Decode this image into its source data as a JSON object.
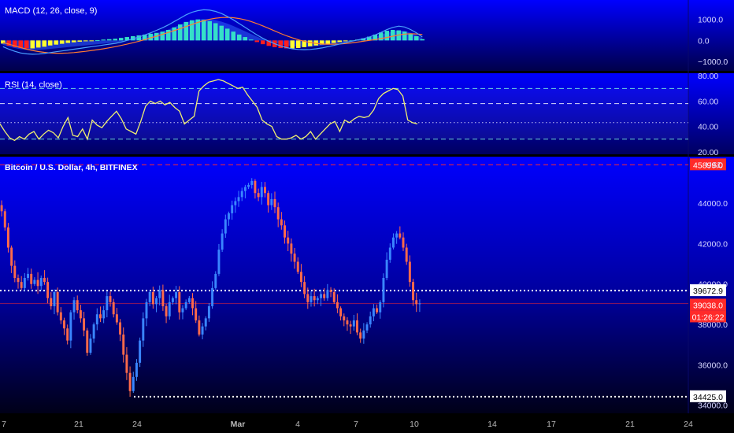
{
  "colors": {
    "panel_top": "#0000ff",
    "panel_bottom": "#000015",
    "separator": "#000000",
    "up_candle": "#3a86ff",
    "down_candle": "#ff6a4a",
    "macd_line": "#4aa0ff",
    "signal_line": "#ff7a30",
    "hist_up": "#35e0c8",
    "hist_down_red": "#ff1e1e",
    "hist_down_yellow": "#ffff30",
    "rsi_line": "#f0f070",
    "rsi_band_upper": "#7ff5e0",
    "rsi_band_mid": "#e6e6ff",
    "red_tag": "#ff2a2a",
    "axis_text": "#d8d8ff",
    "time_axis_bg": "#000000"
  },
  "macd_panel": {
    "title": "MACD (12, 26, close, 9)",
    "ticks": [
      "1000.0",
      "0.0",
      "−1000.0"
    ]
  },
  "rsi_panel": {
    "title": "RSI (14, close)",
    "ticks": [
      "80.00",
      "60.00",
      "40.00",
      "20.00"
    ]
  },
  "price_panel": {
    "title": "Bitcoin / U.S. Dollar, 4h, BITFINEX",
    "currency": "USD",
    "ticks": [
      "44000.0",
      "42000.0",
      "40000.0",
      "38000.0",
      "36000.0",
      "34000.0"
    ],
    "tags": {
      "resistance": "45899.0",
      "level": "39672.9",
      "last_price": "39038.0",
      "countdown": "01:26:22",
      "low": "34425.0"
    }
  },
  "time_axis": {
    "labels": [
      "7",
      "21",
      "24",
      "Mar",
      "4",
      "7",
      "10",
      "14",
      "17",
      "21",
      "24"
    ]
  },
  "chart_data": [
    {
      "type": "bar",
      "name_shown": "MACD (12, 26, close, 9)",
      "description_series": [
        "histogram",
        "macd",
        "signal"
      ],
      "ylim": [
        -1300,
        1700
      ],
      "y_ticks": [
        1000,
        0,
        -1000
      ],
      "histogram": [
        -150,
        -250,
        -320,
        -360,
        -380,
        -380,
        -340,
        -300,
        -240,
        -200,
        -160,
        -120,
        -90,
        -60,
        -40,
        -20,
        10,
        40,
        60,
        80,
        120,
        160,
        200,
        240,
        280,
        320,
        360,
        420,
        500,
        620,
        760,
        880,
        960,
        1000,
        980,
        920,
        820,
        700,
        560,
        420,
        280,
        160,
        40,
        -80,
        -180,
        -260,
        -320,
        -360,
        -380,
        -380,
        -360,
        -320,
        -280,
        -240,
        -200,
        -160,
        -120,
        -80,
        -40,
        0,
        40,
        100,
        180,
        280,
        380,
        460,
        500,
        480,
        420,
        320,
        200,
        60
      ],
      "macd": [
        -300,
        -420,
        -520,
        -600,
        -640,
        -660,
        -650,
        -620,
        -580,
        -540,
        -500,
        -460,
        -420,
        -380,
        -340,
        -300,
        -260,
        -220,
        -180,
        -140,
        -80,
        0,
        80,
        160,
        260,
        360,
        480,
        600,
        740,
        900,
        1060,
        1220,
        1340,
        1420,
        1460,
        1440,
        1380,
        1280,
        1140,
        980,
        800,
        620,
        440,
        260,
        100,
        -40,
        -160,
        -260,
        -340,
        -400,
        -430,
        -440,
        -430,
        -400,
        -360,
        -300,
        -240,
        -170,
        -100,
        -40,
        20,
        80,
        160,
        260,
        380,
        520,
        620,
        680,
        640,
        520,
        360,
        160
      ],
      "signal": [
        -100,
        -180,
        -260,
        -340,
        -420,
        -480,
        -530,
        -570,
        -600,
        -610,
        -610,
        -600,
        -580,
        -550,
        -520,
        -480,
        -440,
        -400,
        -350,
        -300,
        -240,
        -180,
        -110,
        -40,
        40,
        120,
        200,
        290,
        380,
        470,
        560,
        660,
        760,
        860,
        940,
        1010,
        1060,
        1090,
        1100,
        1080,
        1040,
        980,
        900,
        800,
        690,
        570,
        450,
        330,
        220,
        120,
        30,
        -40,
        -100,
        -140,
        -170,
        -180,
        -180,
        -170,
        -150,
        -120,
        -80,
        -40,
        0,
        40,
        90,
        140,
        200,
        260,
        300,
        320,
        310,
        280
      ]
    },
    {
      "type": "line",
      "name_shown": "RSI (14, close)",
      "ylim": [
        18,
        82
      ],
      "y_ticks": [
        80,
        60,
        40,
        20
      ],
      "bands": [
        70,
        58,
        43,
        30
      ],
      "x_index_range": [
        0,
        100
      ],
      "rsi": [
        42,
        36,
        31,
        29,
        32,
        30,
        34,
        36,
        30,
        34,
        37,
        35,
        31,
        40,
        47,
        33,
        32,
        38,
        30,
        45,
        41,
        39,
        44,
        48,
        52,
        46,
        38,
        36,
        34,
        44,
        56,
        60,
        58,
        60,
        57,
        59,
        55,
        52,
        42,
        45,
        48,
        68,
        72,
        75,
        76,
        77,
        76,
        74,
        72,
        70,
        71,
        65,
        60,
        55,
        45,
        42,
        40,
        32,
        30,
        30,
        31,
        33,
        30,
        32,
        36,
        30,
        34,
        38,
        42,
        44,
        36,
        45,
        43,
        46,
        48,
        47,
        48,
        53,
        62,
        66,
        68,
        70,
        69,
        64,
        45,
        43,
        42
      ],
      "rsi_x_end": 86
    },
    {
      "type": "candlestick",
      "name_shown": "Bitcoin / U.S. Dollar, 4h, BITFINEX",
      "ylim": [
        33600,
        46300
      ],
      "y_ticks": [
        44000,
        42000,
        40000,
        38000,
        36000,
        34000
      ],
      "x_labels": [
        "7",
        "21",
        "24",
        "Mar",
        "4",
        "7",
        "10",
        "14",
        "17",
        "21",
        "24"
      ],
      "horizontal_levels": {
        "resistance": 45899.0,
        "level": 39672.9,
        "last_price": 39038.0,
        "low": 34425.0
      },
      "closes": [
        43600,
        42800,
        41800,
        40900,
        40300,
        40100,
        39800,
        40300,
        40500,
        40000,
        40200,
        39900,
        40300,
        40100,
        39300,
        38900,
        39600,
        38600,
        38200,
        37800,
        37200,
        38600,
        39200,
        38700,
        38300,
        37700,
        36600,
        37300,
        38000,
        38500,
        38300,
        38700,
        39400,
        39100,
        38500,
        38100,
        37500,
        36500,
        35600,
        34700,
        35400,
        36100,
        37200,
        38300,
        39100,
        39600,
        39000,
        39300,
        39700,
        38900,
        38400,
        39100,
        39300,
        39600,
        38600,
        38800,
        39100,
        39300,
        38800,
        38200,
        37500,
        37900,
        38300,
        38900,
        39800,
        40500,
        41700,
        42500,
        43200,
        43500,
        43900,
        44100,
        44300,
        44600,
        44800,
        44900,
        45100,
        44500,
        44300,
        44800,
        44500,
        43900,
        44200,
        43800,
        43200,
        42900,
        42300,
        42000,
        41500,
        41100,
        40600,
        40100,
        39500,
        39100,
        39400,
        39200,
        39300,
        39500,
        39300,
        39700,
        39600,
        39100,
        38800,
        38400,
        38200,
        38000,
        37900,
        38200,
        37600,
        37300,
        37700,
        38000,
        38400,
        38800,
        38600,
        39100,
        40300,
        41200,
        41800,
        42300,
        42500,
        42300,
        41800,
        41100,
        40100,
        39200,
        39000,
        39038
      ]
    }
  ]
}
